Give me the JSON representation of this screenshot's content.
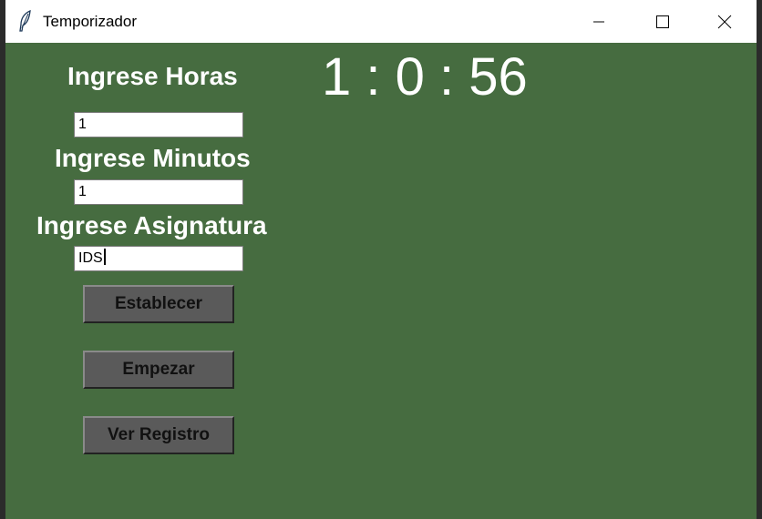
{
  "window": {
    "title": "Temporizador",
    "icon": "feather-icon",
    "controls": [
      "minimize-icon",
      "maximize-icon",
      "close-icon"
    ],
    "background_color": "#466c40"
  },
  "form": {
    "hours_label": "Ingrese Horas",
    "hours_value": "1",
    "minutes_label": "Ingrese Minutos",
    "minutes_value": "1",
    "subject_label": "Ingrese Asignatura",
    "subject_value": "IDS"
  },
  "buttons": {
    "set_label": "Establecer",
    "start_label": "Empezar",
    "log_label": "Ver Registro"
  },
  "timer": {
    "display": "1 : 0 : 56"
  }
}
